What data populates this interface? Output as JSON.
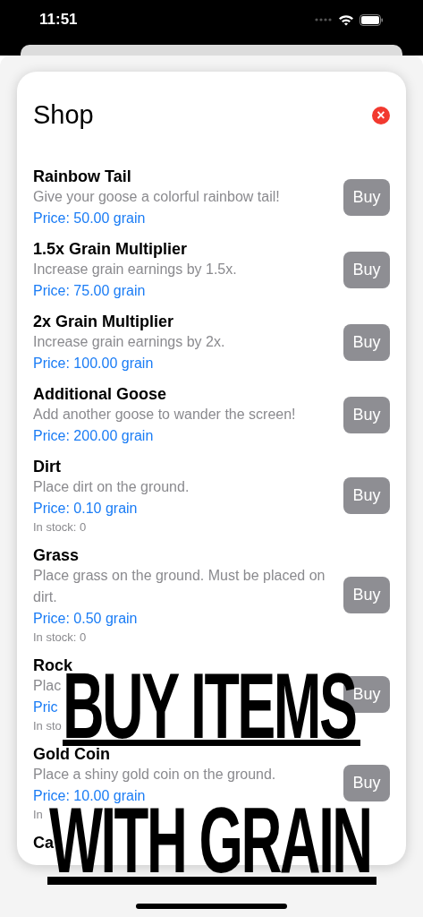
{
  "status_bar": {
    "time": "11:51"
  },
  "sheet": {
    "title": "Shop",
    "close": "×"
  },
  "items": [
    {
      "name": "Rainbow Tail",
      "description": "Give your goose a colorful rainbow tail!",
      "price": "Price: 50.00 grain",
      "button": "Buy"
    },
    {
      "name": "1.5x Grain Multiplier",
      "description": "Increase grain earnings by 1.5x.",
      "price": "Price: 75.00 grain",
      "button": "Buy"
    },
    {
      "name": "2x Grain Multiplier",
      "description": "Increase grain earnings by 2x.",
      "price": "Price: 100.00 grain",
      "button": "Buy"
    },
    {
      "name": "Additional Goose",
      "description": "Add another goose to wander the screen!",
      "price": "Price: 200.00 grain",
      "button": "Buy"
    },
    {
      "name": "Dirt",
      "description": "Place dirt on the ground.",
      "price": "Price: 0.10 grain",
      "stock": "In stock: 0",
      "button": "Buy"
    },
    {
      "name": "Grass",
      "description": "Place grass on the ground. Must be placed on dirt.",
      "price": "Price: 0.50 grain",
      "stock": "In stock: 0",
      "button": "Buy"
    },
    {
      "name": "Rock",
      "description": "Plac",
      "price": "Pric",
      "stock": "In sto",
      "button": "Buy"
    },
    {
      "name": "Gold Coin",
      "description": "Place a shiny gold coin on the ground.",
      "price": "Price: 10.00 grain",
      "stock": "In",
      "button": "Buy"
    },
    {
      "name": "Ca"
    }
  ],
  "caption": {
    "lines": [
      "BUY ITEMS",
      "WITH GRAIN"
    ]
  }
}
